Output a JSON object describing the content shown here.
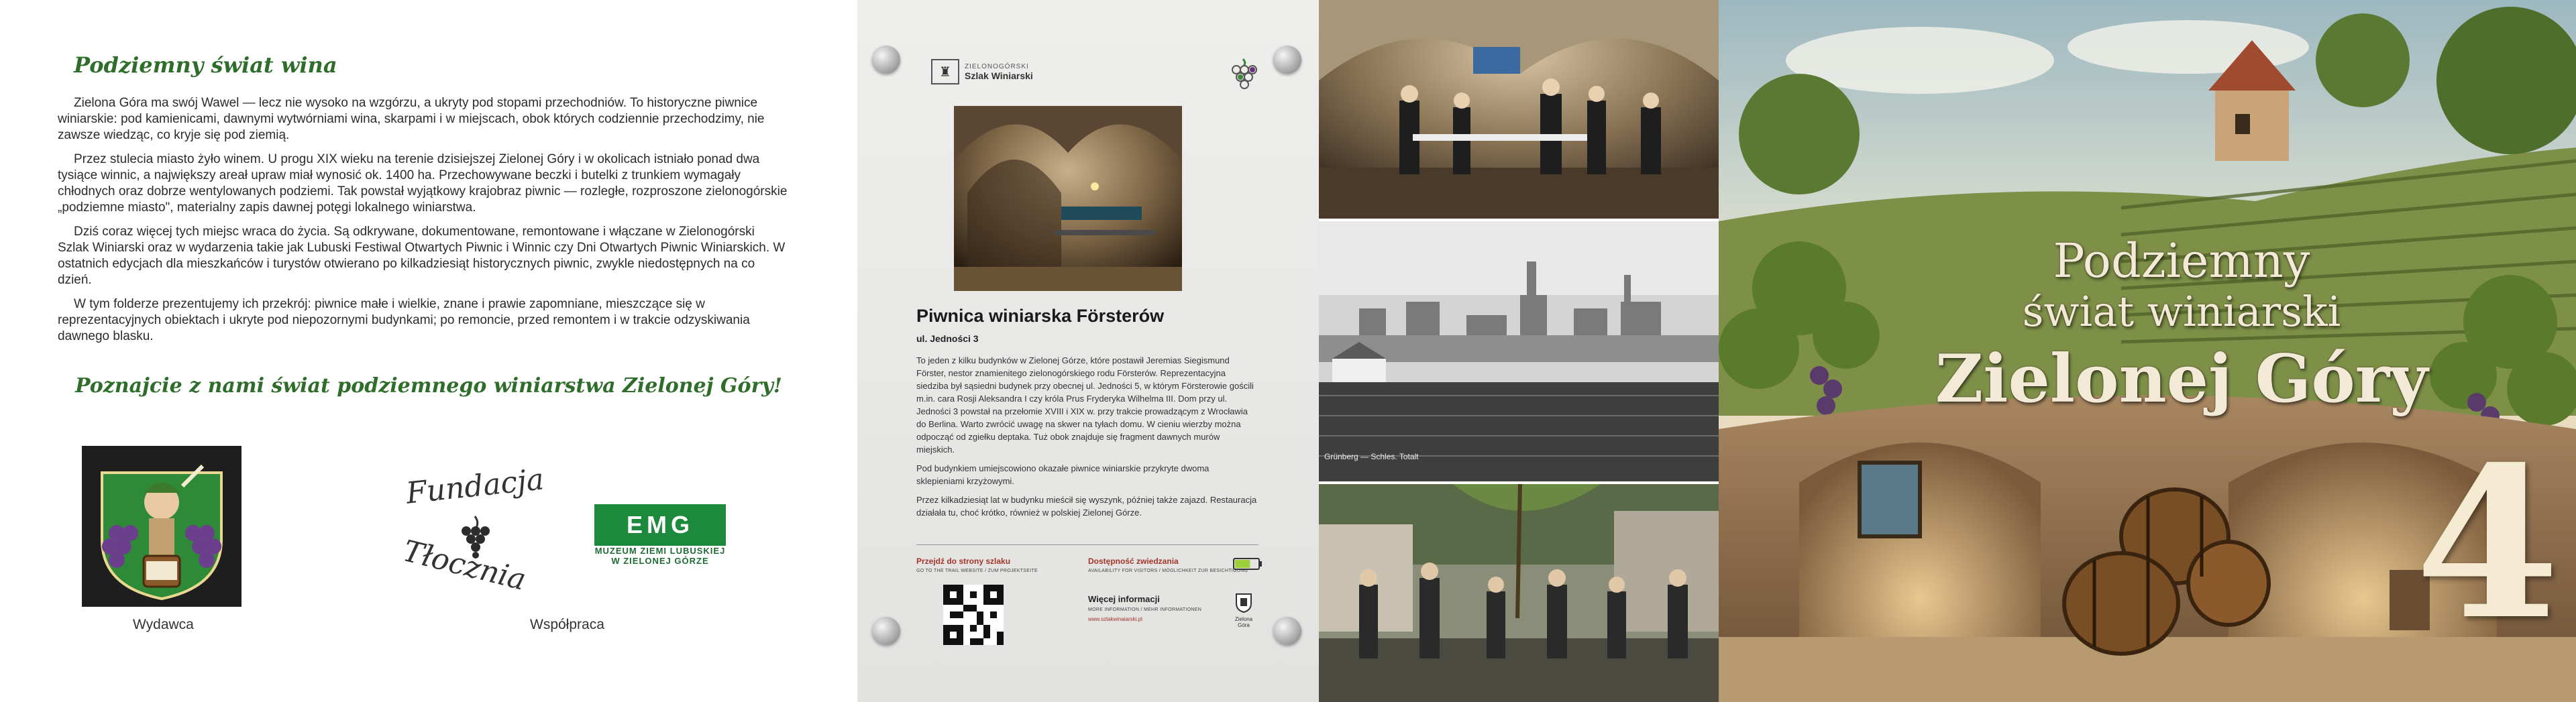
{
  "left_page": {
    "title": "Podziemny świat wina",
    "paragraphs": [
      "Zielona Góra ma swój Wawel — lecz nie wysoko na wzgórzu, a ukryty pod stopami przechodniów. To historyczne piwnice winiarskie: pod kamienicami, dawnymi wytwórniami wina, skarpami i w miejscach, obok których codziennie przechodzimy, nie zawsze wiedząc, co kryje się pod ziemią.",
      "Przez stulecia miasto żyło winem. U progu XIX wieku na terenie dzisiejszej Zielonej Góry i w okolicach istniało ponad dwa tysiące winnic, a największy areał upraw miał wynosić ok. 1400 ha. Przechowywane beczki i butelki z trunkiem wymagały chłodnych oraz dobrze wentylowanych podziemi. Tak powstał wyjątkowy krajobraz piwnic — rozległe, rozproszone zielonogórskie „podziemne miasto\", materialny zapis dawnej potęgi lokalnego winiarstwa.",
      "Dziś coraz więcej tych miejsc wraca do życia. Są odkrywane, dokumentowane, remontowane i włączane w Zielonogórski Szlak Winiarski oraz w wydarzenia takie jak Lubuski Festiwal Otwartych Piwnic i Winnic czy Dni Otwartych Piwnic Winiarskich. W ostatnich edycjach dla mieszkańców i turystów otwierano po kilkadziesiąt historycznych piwnic, zwykle niedostępnych na co dzień.",
      "W tym folderze prezentujemy ich przekrój: piwnice małe i wielkie, znane i prawie zapomniane, mieszczące się w reprezentacyjnych obiektach i ukryte pod niepozornymi budynkami; po remoncie, przed remontem i w trakcie odzyskiwania dawnego blasku."
    ],
    "invitation": "Poznajcie z nami świat podziemnego winiarstwa Zielonej Góry!",
    "publisher_caption": "Wydawca",
    "cooperation_caption": "Współpraca",
    "foundation_name_1": "Fundacja",
    "foundation_name_2": "Tłocznia",
    "museum_line_1": "MUZEUM ZIEMI LUBUSKIEJ",
    "museum_line_2": "W ZIELONEJ GÓRZE",
    "museum_mark": "EMG"
  },
  "board": {
    "trail_small": "ZIELONOGÓRSKI",
    "trail_name": "Szlak Winiarski",
    "title": "Piwnica winiarska Försterów",
    "address": "ul. Jedności 3",
    "paragraphs": [
      "To jeden z kilku budynków w Zielonej Górze, które postawił Jeremias Siegismund Förster, nestor znamienitego zielonogórskiego rodu Försterów. Reprezentacyjna siedziba był sąsiedni budynek przy obecnej ul. Jedności 5, w którym Försterowie gościli m.in. cara Rosji Aleksandra I czy króla Prus Fryderyka Wilhelma III. Dom przy ul. Jedności 3 powstał na przełomie XVIII i XIX w. przy trakcie prowadzącym z Wrocławia do Berlina. Warto zwrócić uwagę na skwer na tyłach domu. W cieniu wierzby można odpocząć od zgiełku deptaka. Tuż obok znajduje się fragment dawnych murów miejskich.",
      "Pod budynkiem umiejscowiono okazałe piwnice winiarskie przykryte dwoma sklepieniami krzyżowymi.",
      "Przez kilkadziesiąt lat w budynku mieścił się wyszynk, później także zajazd. Restauracja działała tu, choć krótko, również w polskiej Zielonej Górze."
    ],
    "link_label": "Przejdź do strony szlaku",
    "link_sub": "GO TO THE TRAIL WEBSITE / ZUM PROJEKTSEITE",
    "access_label": "Dostępność zwiedzania",
    "access_sub": "AVAILABILITY FOR VISITORS / MÖGLICHKEIT ZUR BESICHTIGUNG",
    "more_label": "Więcej informacji",
    "more_sub": "MORE INFORMATION / MEHR INFORMATIONEN",
    "url": "www.szlakwinaiarski.pl",
    "city_label": "Zielona Góra",
    "access_level": 0.66
  },
  "photos": {
    "archive_caption": "Grünberg — Schles. Totalt"
  },
  "cover": {
    "line1": "Podziemny",
    "line2": "świat winiarski",
    "line3": "Zielonej Góry",
    "number": "4"
  }
}
